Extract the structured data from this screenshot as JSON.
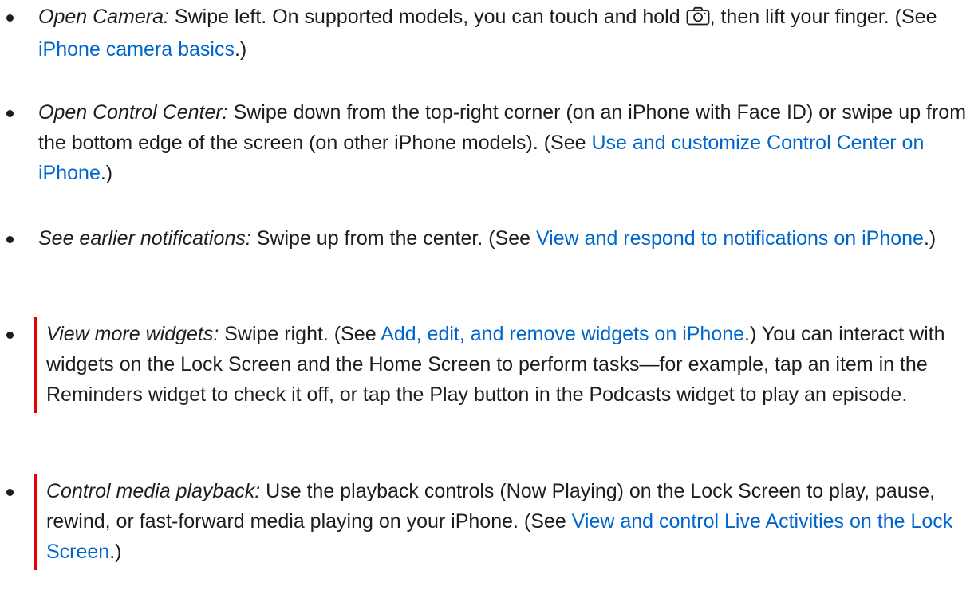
{
  "items": [
    {
      "term": "Open Camera:",
      "text1": " Swipe left. On supported models, you can touch and hold ",
      "icon": "camera-icon",
      "text2": ", then lift your finger. (See ",
      "link": "iPhone camera basics",
      "text3": ".)"
    },
    {
      "term": "Open Control Center:",
      "text1": " Swipe down from the top-right corner (on an iPhone with Face ID) or swipe up from the bottom edge of the screen (on other iPhone models). (See ",
      "link": "Use and customize Control Center on iPhone",
      "text2": ".)"
    },
    {
      "term": "See earlier notifications:",
      "text1": " Swipe up from the center. (See ",
      "link": "View and respond to notifications on iPhone",
      "text2": ".)"
    },
    {
      "term": "View more widgets:",
      "text1": " Swipe right. (See ",
      "link": "Add, edit, and remove widgets on iPhone",
      "text2": ".) You can interact with widgets on the Lock Screen and the Home Screen to perform tasks—for example, tap an item in the Reminders widget to check it off, or tap the Play button in the Podcasts widget to play an episode."
    },
    {
      "term": "Control media playback:",
      "text1": " Use the playback controls (Now Playing) on the Lock Screen to play, pause, rewind, or fast-forward media playing on your iPhone. (See ",
      "link": "View and control Live Activities on the Lock Screen",
      "text2": ".)"
    }
  ],
  "colors": {
    "text": "#1d1d1f",
    "link": "#0066cc",
    "change_bar": "#e30000"
  }
}
